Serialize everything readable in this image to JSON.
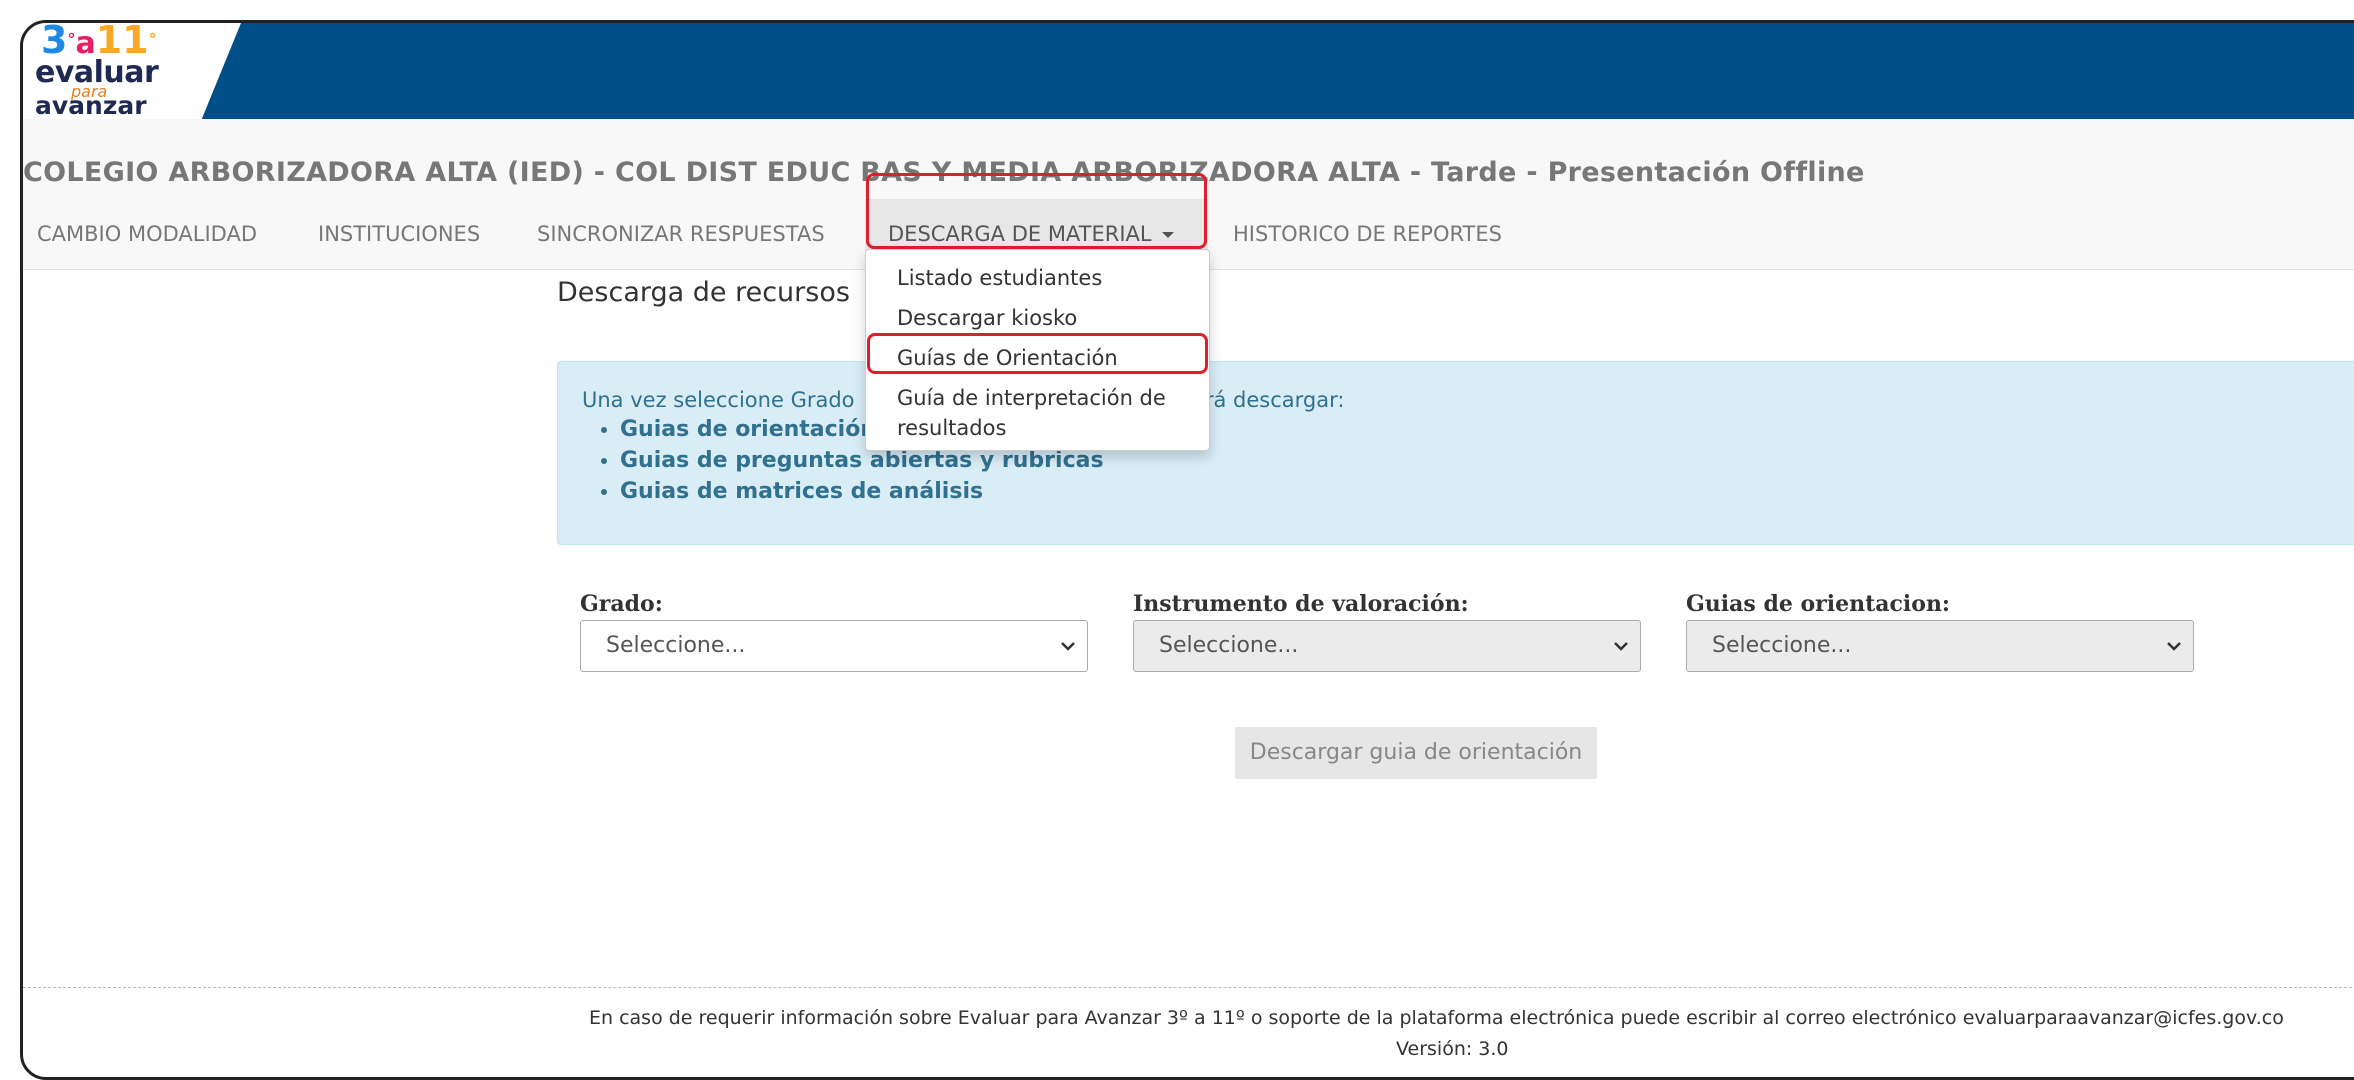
{
  "logo": {
    "three": "3",
    "a": "a",
    "eleven": "11",
    "degree": "°",
    "evaluar": "evaluar",
    "para": "para",
    "avanzar": "avanzar"
  },
  "header": {
    "school_title": "COLEGIO ARBORIZADORA ALTA (IED) - COL DIST EDUC BAS Y MEDIA ARBORIZADORA ALTA - Tarde - Presentación Offline"
  },
  "nav": {
    "items": [
      {
        "label": "CAMBIO MODALIDAD"
      },
      {
        "label": "INSTITUCIONES"
      },
      {
        "label": "SINCRONIZAR RESPUESTAS"
      },
      {
        "label": "DESCARGA DE MATERIAL"
      },
      {
        "label": "HISTORICO DE REPORTES"
      }
    ]
  },
  "dropdown": {
    "items": [
      {
        "label": "Listado estudiantes"
      },
      {
        "label": "Descargar kiosko"
      },
      {
        "label": "Guías de Orientación"
      },
      {
        "label_line1": "Guía de interpretación de",
        "label_line2": "resultados"
      }
    ]
  },
  "main": {
    "title": "Descarga de recursos",
    "alert": {
      "intro_start": "Una vez seleccione Grado",
      "intro_end": "drá descargar:",
      "bullets": [
        "Guias de orientación",
        "Guias de preguntas abiertas y rubricas",
        "Guias de matrices de análisis"
      ]
    },
    "filters": [
      {
        "label": "Grado:",
        "value": "Seleccione..."
      },
      {
        "label": "Instrumento de valoración:",
        "value": "Seleccione..."
      },
      {
        "label": "Guias de orientacion:",
        "value": "Seleccione..."
      }
    ],
    "download_button": "Descargar guia de orientación"
  },
  "footer": {
    "text": "En caso de requerir información sobre Evaluar para Avanzar 3º a 11º o soporte de la plataforma electrónica puede escribir al correo electrónico evaluarparaavanzar@icfes.gov.co",
    "version": "Versión: 3.0"
  },
  "colors": {
    "topbar": "#004f88",
    "highlight": "#e01e2d",
    "alert_bg": "#d9edf7",
    "alert_text": "#31708f"
  }
}
